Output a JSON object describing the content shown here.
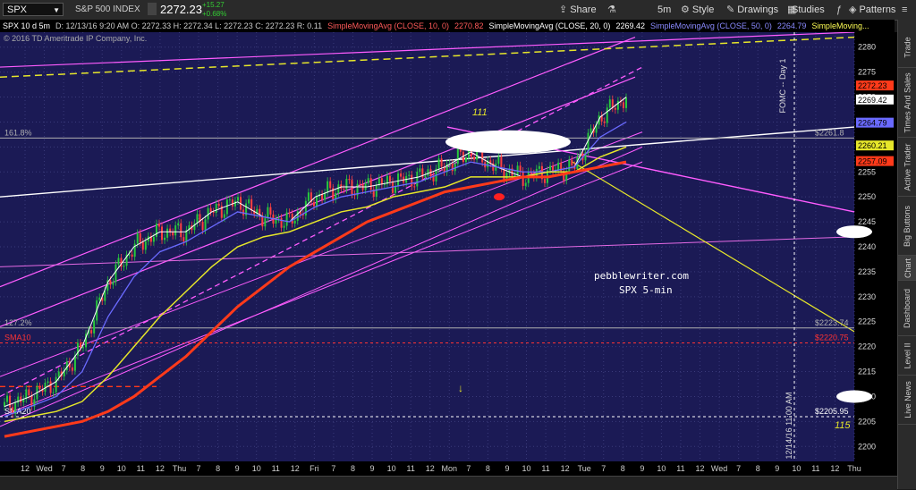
{
  "toolbar": {
    "symbol": "SPX",
    "index_name": "S&P 500 INDEX",
    "last_price": "2272.23",
    "change": "+15.27",
    "change_pct": "+0.68%",
    "buttons": [
      {
        "label": "Share",
        "icon": "share-icon"
      },
      {
        "label": "",
        "icon": "flask-icon"
      },
      {
        "label": "5m",
        "icon": ""
      },
      {
        "label": "Style",
        "icon": "gear-icon"
      },
      {
        "label": "Drawings",
        "icon": "pencil-icon"
      },
      {
        "label": "",
        "icon": "calendar-icon"
      },
      {
        "label": "Studies",
        "icon": "studies-icon"
      },
      {
        "label": "",
        "icon": "fx-icon"
      },
      {
        "label": "Patterns",
        "icon": "patterns-icon"
      },
      {
        "label": "",
        "icon": "menu-icon"
      }
    ]
  },
  "infobar": {
    "header": "SPX 10 d 5m",
    "ohlc": "D: 12/13/16 9:20 AM   O: 2272.33   H: 2272.34   L: 2272.23   C: 2272.23   R: 0.11",
    "sma10": "SimpleMovingAvg (CLOSE, 10, 0)",
    "sma10_val": "2270.82",
    "sma20": "SimpleMovingAvg (CLOSE, 20, 0)",
    "sma20_val": "2269.42",
    "sma50": "SimpleMovingAvg (CLOSE, 50, 0)",
    "sma50_val": "2264.79",
    "sma_more": "SimpleMoving...",
    "copyright": "© 2016 TD Ameritrade IP Company, Inc."
  },
  "side_tabs": [
    "Trade",
    "Times And Sales",
    "Active Trader",
    "Big Buttons",
    "Chart",
    "Dashboard",
    "Level II",
    "Live News"
  ],
  "colors": {
    "background": "#1b1a55",
    "price_bars": "#28c83c",
    "sma10": "#ffffff",
    "sma20": "#6a6aff",
    "sma50": "#e6e62a",
    "sma200": "#ff3a1a",
    "channel": "#ff5cff",
    "fib": "#b0b0b0"
  },
  "chart_data": {
    "type": "line",
    "ylim": [
      2197,
      2283
    ],
    "yticks": [
      2200,
      2205,
      2210,
      2215,
      2220,
      2225,
      2230,
      2235,
      2240,
      2245,
      2250,
      2255,
      2260,
      2265,
      2270,
      2275,
      2280
    ],
    "xticks": [
      "12",
      "Wed",
      "7",
      "8",
      "9",
      "10",
      "11",
      "12",
      "Thu",
      "7",
      "8",
      "9",
      "10",
      "11",
      "12",
      "Fri",
      "7",
      "8",
      "9",
      "10",
      "11",
      "12",
      "Mon",
      "7",
      "8",
      "9",
      "10",
      "11",
      "12",
      "Tue",
      "7",
      "8",
      "9",
      "10",
      "11",
      "12",
      "Wed",
      "7",
      "8",
      "9",
      "10",
      "11",
      "12",
      "Thu"
    ],
    "price_labels": [
      {
        "value": 2272.23,
        "text": "2272.23",
        "color": "#ff3a1a"
      },
      {
        "value": 2269.42,
        "text": "2269.42",
        "color": "#ffffff"
      },
      {
        "value": 2264.79,
        "text": "2264.79",
        "color": "#6a6aff"
      },
      {
        "value": 2260.21,
        "text": "2260.21",
        "color": "#e6e62a"
      },
      {
        "value": 2257.09,
        "text": "2257.09",
        "color": "#ff3a1a"
      }
    ],
    "levels": [
      {
        "value": 2261.8,
        "left": "161.8%",
        "right": "$2261.8",
        "color": "#b0b0b0"
      },
      {
        "value": 2223.74,
        "left": "127.2%",
        "right": "$2223.74",
        "color": "#b0b0b0"
      },
      {
        "value": 2220.75,
        "left": "SMA10",
        "right": "$2220.75",
        "color": "#ff3333"
      },
      {
        "value": 2205.95,
        "left": "SMA20",
        "right": "$2205.95",
        "color": "#ffffff"
      }
    ],
    "annotations": [
      "pebblewriter.com",
      "SPX 5-min",
      "111",
      "115",
      "FOMC -- Day 1",
      "12/14/16 11:00 AM"
    ],
    "series": [
      {
        "name": "SMA10",
        "values": [
          2208,
          2210,
          2213,
          2220,
          2233,
          2240,
          2243,
          2243,
          2247,
          2249,
          2246,
          2245,
          2250,
          2252,
          2252,
          2253,
          2254,
          2256,
          2259,
          2256,
          2254,
          2255,
          2256,
          2266,
          2270
        ]
      },
      {
        "name": "SMA20",
        "values": [
          2206,
          2208,
          2210,
          2215,
          2226,
          2234,
          2239,
          2241,
          2244,
          2247,
          2246,
          2245,
          2248,
          2250,
          2251,
          2252,
          2253,
          2255,
          2257,
          2256,
          2255,
          2255,
          2256,
          2262,
          2265
        ]
      },
      {
        "name": "SMA50",
        "values": [
          2205,
          2206,
          2207,
          2209,
          2214,
          2220,
          2226,
          2231,
          2236,
          2240,
          2242,
          2243,
          2245,
          2247,
          2248,
          2250,
          2251,
          2252,
          2254,
          2254,
          2254,
          2255,
          2255,
          2258,
          2260
        ]
      },
      {
        "name": "SMA200",
        "values": [
          2202,
          2203,
          2204,
          2205,
          2207,
          2210,
          2214,
          2218,
          2223,
          2228,
          2232,
          2236,
          2239,
          2242,
          2245,
          2247,
          2249,
          2251,
          2252,
          2253,
          2254,
          2254,
          2255,
          2256,
          2257
        ]
      }
    ]
  }
}
